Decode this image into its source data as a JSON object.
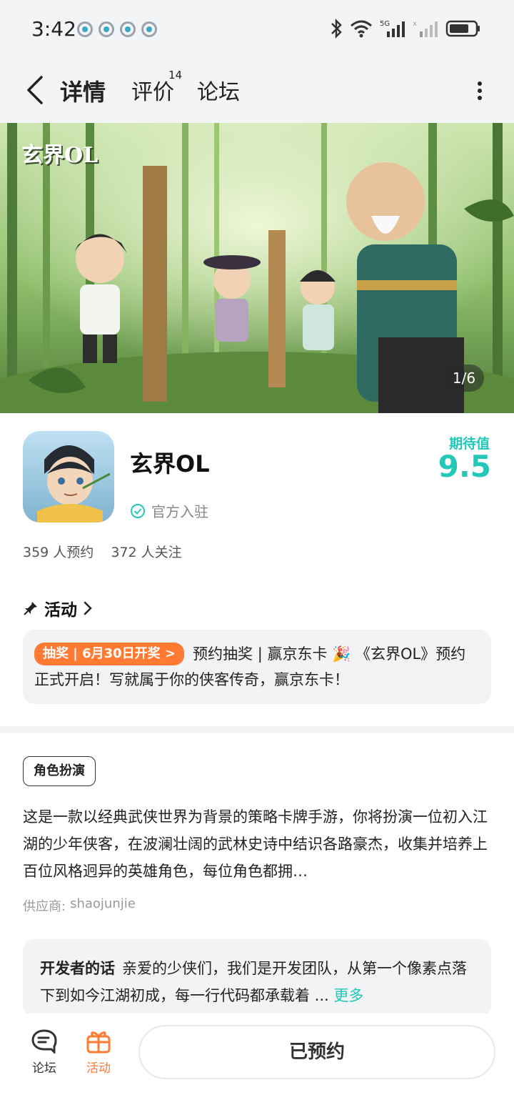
{
  "status_bar": {
    "time": "3:42"
  },
  "nav": {
    "tabs": [
      {
        "label": "详情"
      },
      {
        "label": "评价",
        "badge": "14"
      },
      {
        "label": "论坛"
      }
    ]
  },
  "banner": {
    "logo_text": "玄界OL",
    "counter": "1/6"
  },
  "app": {
    "name": "玄界OL",
    "official_label": "官方入驻",
    "expect_label": "期待值",
    "expect_value": "9.5",
    "reservations": "359 人预约",
    "followers": "372 人关注"
  },
  "activity": {
    "header": "活动",
    "tag": "抽奖 | 6月30日开奖 >",
    "text": "预约抽奖 | 赢京东卡 🎉 《玄界OL》预约正式开启！写就属于你的侠客传奇，赢京东卡！"
  },
  "description": {
    "genre": "角色扮演",
    "text": "这是一款以经典武侠世界为背景的策略卡牌手游，你将扮演一位初入江湖的少年侠客，在波澜壮阔的武林史诗中结识各路豪杰，收集并培养上百位风格迥异的英雄角色，每位角色都拥…",
    "supplier_label": "供应商:",
    "supplier_value": "shaojunjie"
  },
  "developer": {
    "title": "开发者的话",
    "text": "亲爱的少侠们，我们是开发团队，从第一个像素点落下到如今江湖初成，每一行代码都承载着 ...",
    "more": "更多"
  },
  "bottom_bar": {
    "forum_label": "论坛",
    "activity_label": "活动",
    "reserve_button": "已预约"
  },
  "colors": {
    "accent": "#25c7b8",
    "orange": "#ff7a33"
  }
}
